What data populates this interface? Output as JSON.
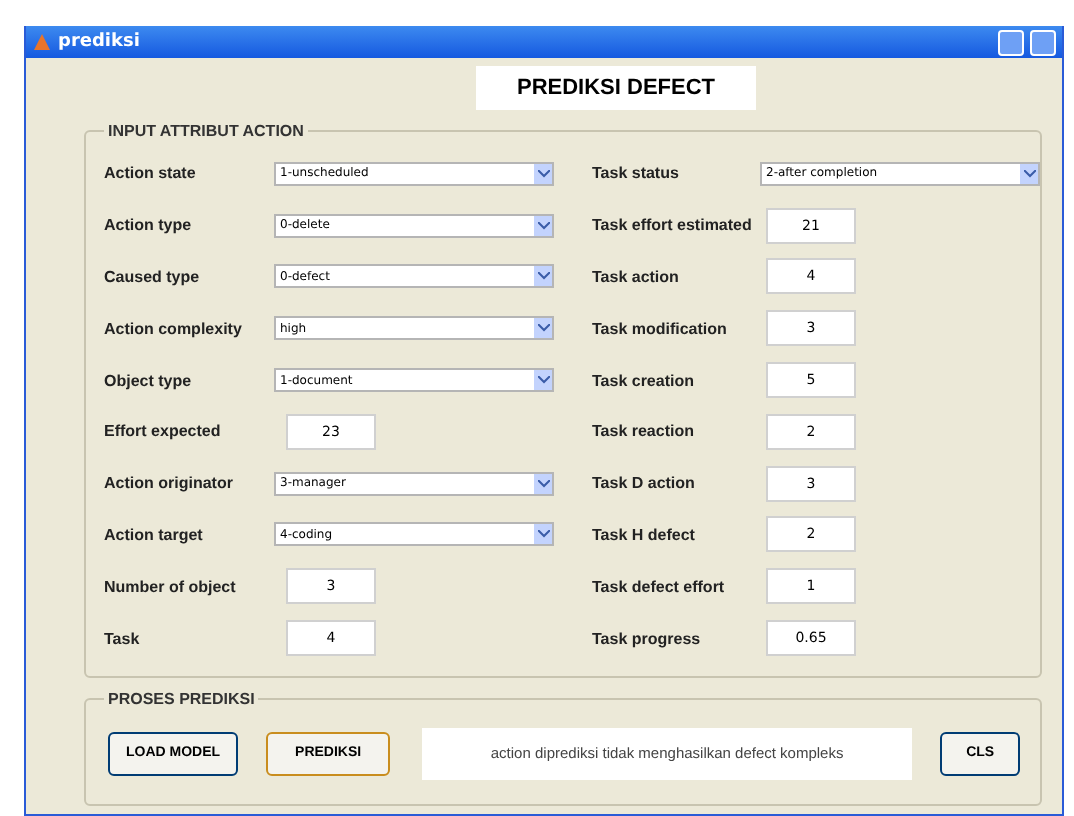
{
  "window": {
    "title": "prediksi"
  },
  "heading": "PREDIKSI DEFECT",
  "input_group": {
    "title": "INPUT ATTRIBUT ACTION",
    "left_fields": [
      {
        "label": "Action state",
        "kind": "dropdown",
        "value": "1-unscheduled"
      },
      {
        "label": "Action type",
        "kind": "dropdown",
        "value": "0-delete"
      },
      {
        "label": "Caused type",
        "kind": "dropdown",
        "value": "0-defect"
      },
      {
        "label": "Action complexity",
        "kind": "dropdown",
        "value": "high"
      },
      {
        "label": "Object type",
        "kind": "dropdown",
        "value": "1-document"
      },
      {
        "label": "Effort expected",
        "kind": "text",
        "value": "23"
      },
      {
        "label": "Action originator",
        "kind": "dropdown",
        "value": "3-manager"
      },
      {
        "label": "Action target",
        "kind": "dropdown",
        "value": "4-coding"
      },
      {
        "label": "Number of object",
        "kind": "text",
        "value": "3"
      },
      {
        "label": "Task",
        "kind": "text",
        "value": "4"
      }
    ],
    "right_fields": [
      {
        "label": "Task status",
        "kind": "dropdown",
        "value": "2-after completion"
      },
      {
        "label": "Task effort estimated",
        "kind": "text",
        "value": "21"
      },
      {
        "label": "Task action",
        "kind": "text",
        "value": "4"
      },
      {
        "label": "Task modification",
        "kind": "text",
        "value": "3"
      },
      {
        "label": "Task creation",
        "kind": "text",
        "value": "5"
      },
      {
        "label": "Task reaction",
        "kind": "text",
        "value": "2"
      },
      {
        "label": "Task D action",
        "kind": "text",
        "value": "3"
      },
      {
        "label": "Task H defect",
        "kind": "text",
        "value": "2"
      },
      {
        "label": "Task defect effort",
        "kind": "text",
        "value": "1"
      },
      {
        "label": "Task progress",
        "kind": "text",
        "value": "0.65"
      }
    ]
  },
  "process_group": {
    "title": "PROSES PREDIKSI",
    "buttons": [
      {
        "label": "LOAD MODEL",
        "selected": false
      },
      {
        "label": "PREDIKSI",
        "selected": true
      }
    ],
    "result": "action diprediksi tidak menghasilkan defect kompleks",
    "clear_button": "CLS"
  }
}
